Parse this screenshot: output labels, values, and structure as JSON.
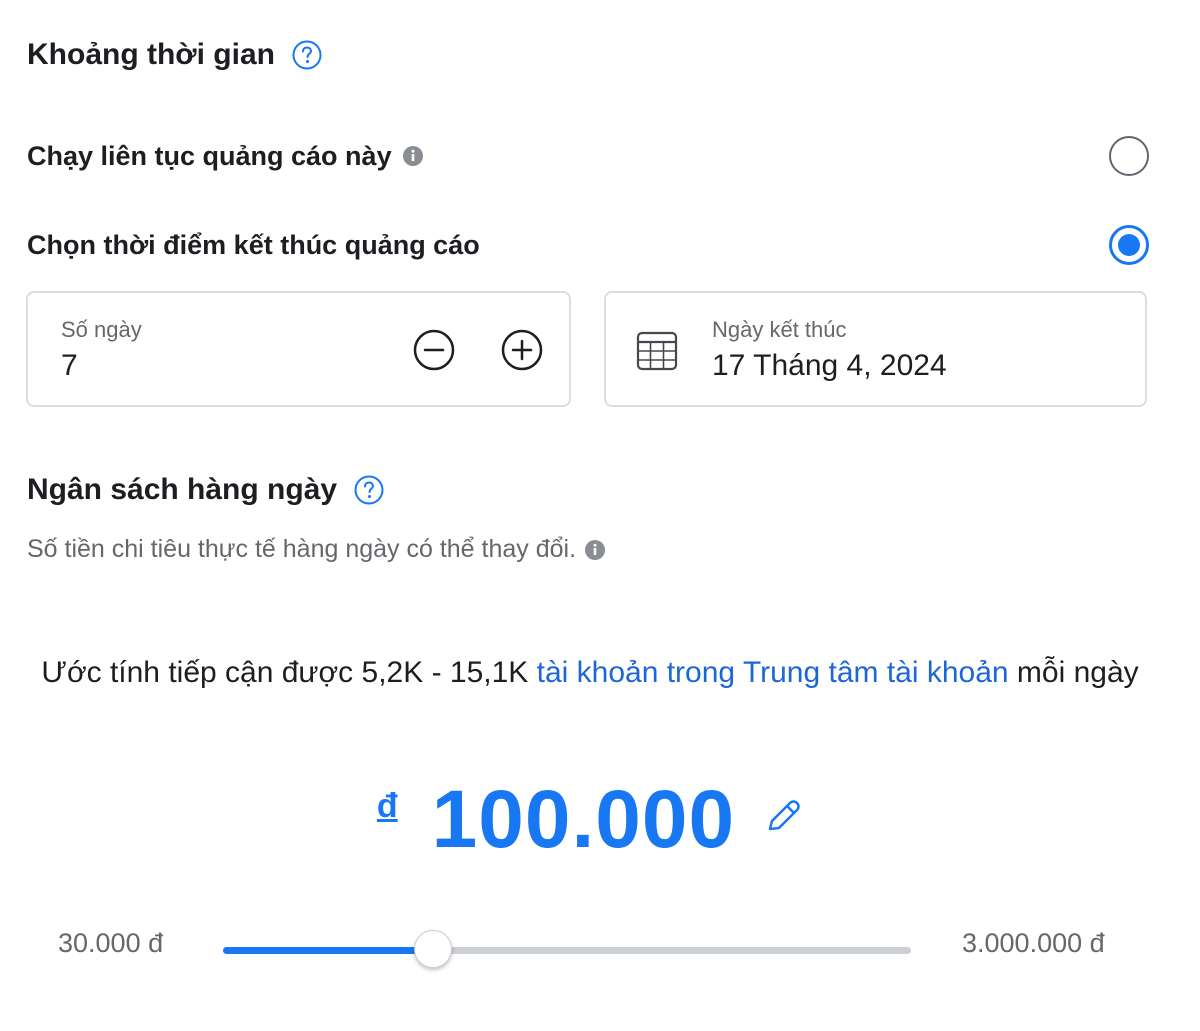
{
  "duration": {
    "title": "Khoảng thời gian",
    "options": [
      {
        "label": "Chạy liên tục quảng cáo này",
        "selected": false
      },
      {
        "label": "Chọn thời điểm kết thúc quảng cáo",
        "selected": true
      }
    ],
    "days_field": {
      "caption": "Số ngày",
      "value": "7"
    },
    "end_date_field": {
      "caption": "Ngày kết thúc",
      "value": "17 Tháng 4, 2024"
    }
  },
  "budget": {
    "title": "Ngân sách hàng ngày",
    "subtitle": "Số tiền chi tiêu thực tế hàng ngày có thể thay đổi.",
    "estimate_prefix": "Ước tính tiếp cận được 5,2K - 15,1K ",
    "estimate_link": "tài khoản trong Trung tâm tài khoản",
    "estimate_suffix": " mỗi ngày",
    "currency_symbol": "đ",
    "amount": "100.000",
    "slider": {
      "min_label": "30.000 đ",
      "max_label": "3.000.000 đ",
      "position_fraction": 0.305
    }
  },
  "icons": {
    "help": "question-circle-icon",
    "info": "info-circle-icon",
    "minus": "minus-circle-icon",
    "plus": "plus-circle-icon",
    "calendar": "calendar-icon",
    "edit": "pencil-icon"
  },
  "colors": {
    "accent": "#1877f2",
    "link": "#1b67d8",
    "muted": "#65676b",
    "text": "#1c1e21"
  }
}
